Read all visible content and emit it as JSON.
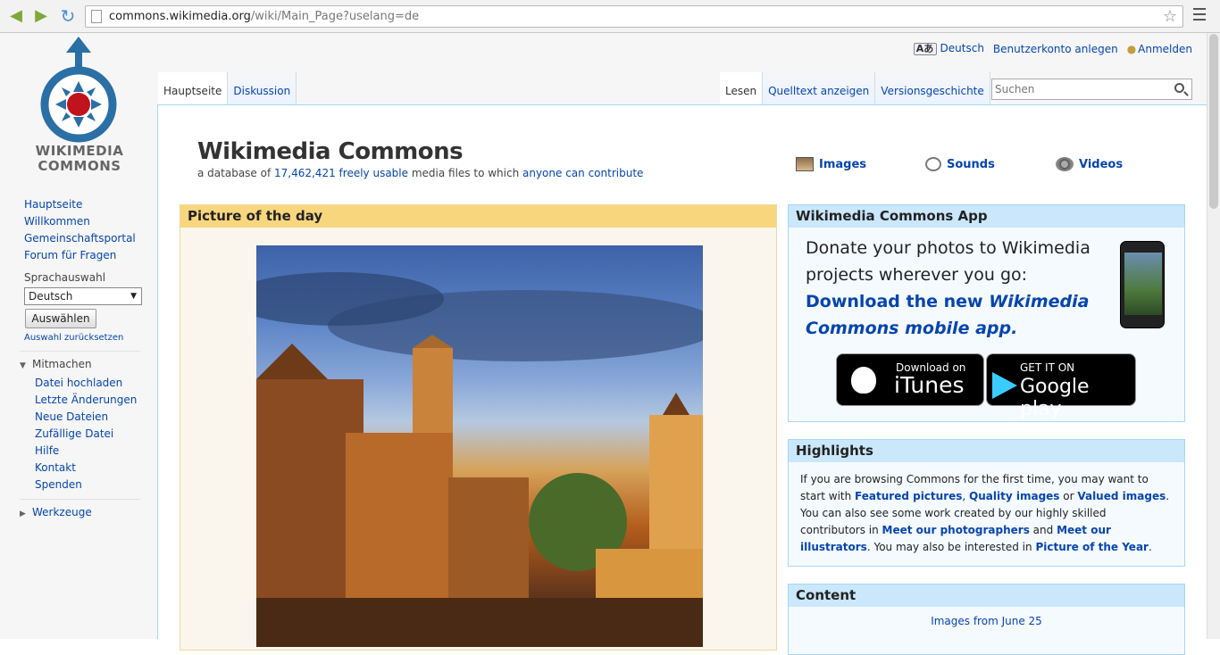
{
  "browser": {
    "url_host": "commons.wikimedia.org",
    "url_rest": "/wiki/Main_Page?uselang=de"
  },
  "logo": {
    "line1": "WIKIMEDIA",
    "line2": "COMMONS"
  },
  "personal": {
    "language": "Deutsch",
    "create_account": "Benutzerkonto anlegen",
    "login": "Anmelden"
  },
  "tabs_left": [
    "Hauptseite",
    "Diskussion"
  ],
  "tabs_right": [
    "Lesen",
    "Quelltext anzeigen",
    "Versionsgeschichte"
  ],
  "search": {
    "placeholder": "Suchen"
  },
  "sidebar": {
    "main_links": [
      "Hauptseite",
      "Willkommen",
      "Gemeinschaftsportal",
      "Forum für Fragen"
    ],
    "language_label": "Sprachauswahl",
    "language_selected": "Deutsch",
    "apply_button": "Auswählen",
    "reset_link": "Auswahl zurücksetzen",
    "mitmachen_heading": "Mitmachen",
    "mitmachen_links": [
      "Datei hochladen",
      "Letzte Änderungen",
      "Neue Dateien",
      "Zufällige Datei",
      "Hilfe",
      "Kontakt",
      "Spenden"
    ],
    "werkzeuge_heading": "Werkzeuge"
  },
  "header": {
    "title": "Wikimedia Commons",
    "tagline_1": "a database of ",
    "tagline_count": "17,462,421",
    "tagline_2": " ",
    "tagline_freely": "freely usable",
    "tagline_3": " media files to which ",
    "tagline_anyone": "anyone can contribute"
  },
  "media_links": {
    "images": "Images",
    "sounds": "Sounds",
    "videos": "Videos"
  },
  "potd": {
    "heading": "Picture of the day"
  },
  "app_box": {
    "heading": "Wikimedia Commons App",
    "text_plain": "Donate your photos to Wikimedia projects wherever you go: ",
    "text_link1": "Download the new ",
    "text_link2": "Wikimedia Commons mobile app.",
    "itunes_small": "Download on",
    "itunes_big": "iTunes",
    "gplay_small": "GET IT ON",
    "gplay_big": "Google play"
  },
  "highlights": {
    "heading": "Highlights",
    "p1": "If you are browsing Commons for the first time, you may want to start with ",
    "l1": "Featured pictures",
    "p2": ", ",
    "l2": "Quality images",
    "p3": " or ",
    "l3": "Valued images",
    "p4": ". You can also see some work created by our highly skilled contributors in ",
    "l4": "Meet our photographers",
    "p5": " and ",
    "l5": "Meet our illustrators",
    "p6": ". You may also be interested in ",
    "l6": "Picture of the Year",
    "p7": "."
  },
  "content_box": {
    "heading": "Content",
    "link": "Images from June 25"
  }
}
